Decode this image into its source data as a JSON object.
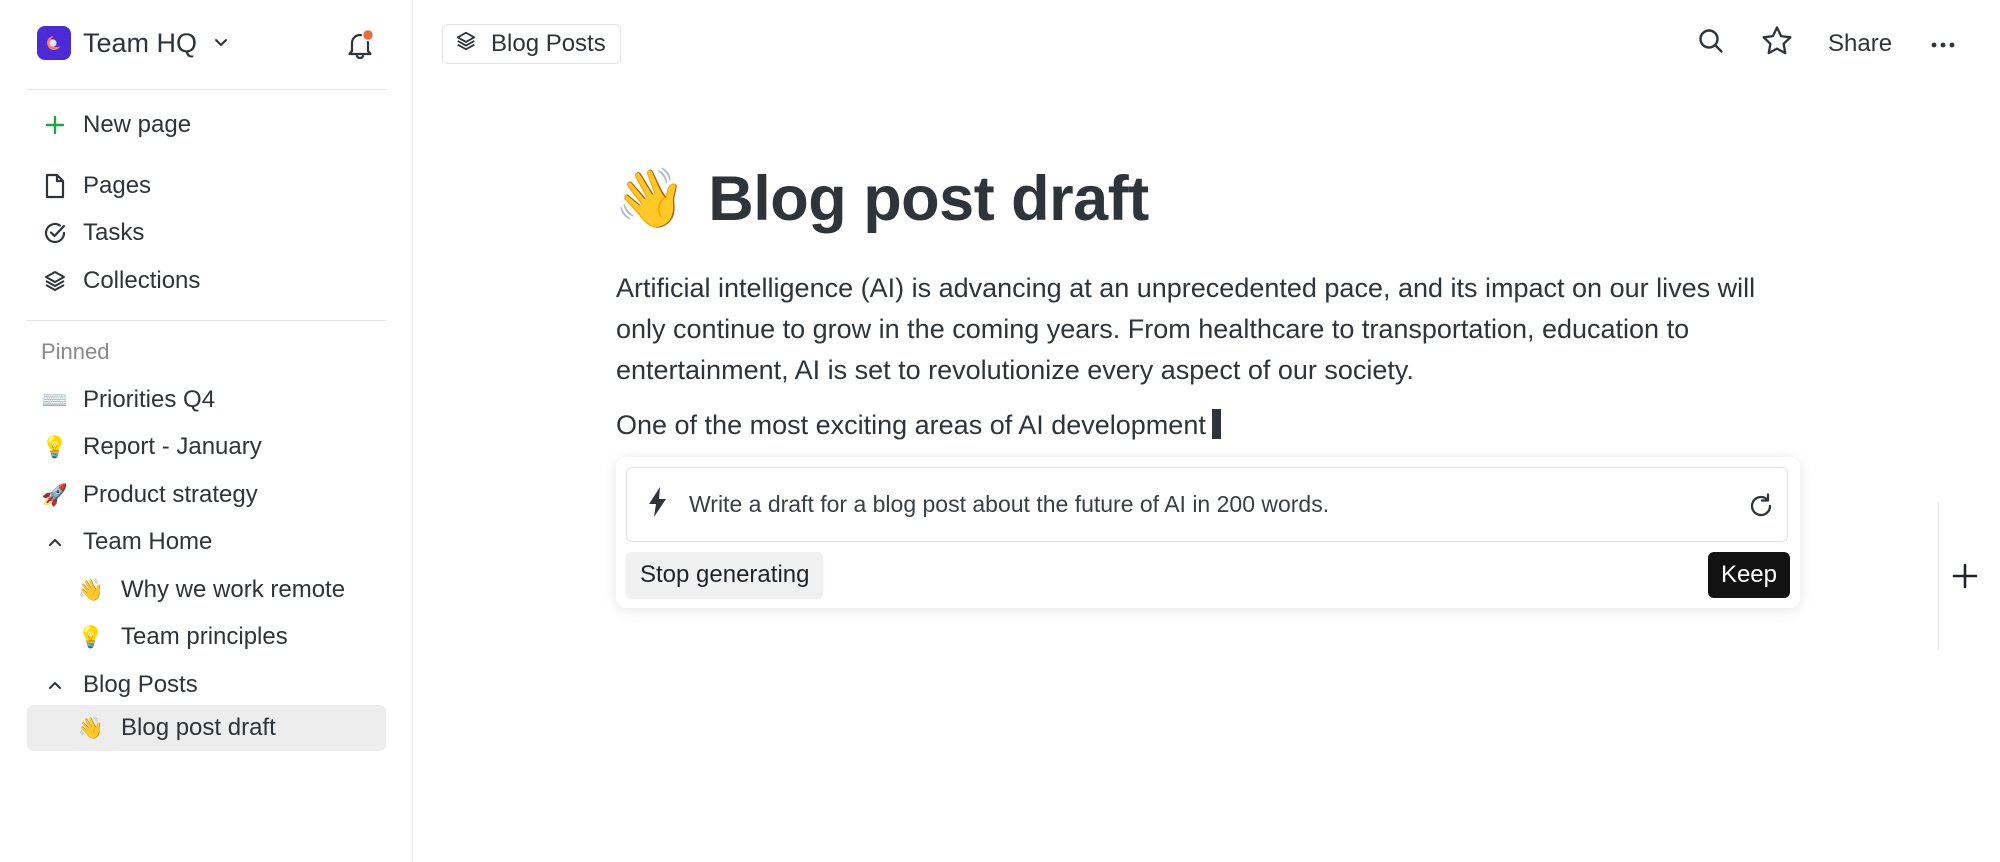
{
  "workspace": {
    "name": "Team HQ"
  },
  "sidebar": {
    "new_page": "New page",
    "primary": [
      {
        "label": "Pages",
        "icon": "page-icon"
      },
      {
        "label": "Tasks",
        "icon": "task-check-icon"
      },
      {
        "label": "Collections",
        "icon": "layers-icon"
      }
    ],
    "pinned_heading": "Pinned",
    "pinned": [
      {
        "emoji": "⌨️",
        "label": "Priorities Q4"
      },
      {
        "emoji": "💡",
        "label": "Report - January"
      },
      {
        "emoji": "🚀",
        "label": "Product strategy"
      },
      {
        "label": "Team Home",
        "expanded": true
      },
      {
        "emoji": "👋",
        "label": "Why we work remote"
      },
      {
        "emoji": "💡",
        "label": "Team principles"
      },
      {
        "label": "Blog Posts",
        "expanded": true
      },
      {
        "emoji": "👋",
        "label": "Blog post draft",
        "active": true
      }
    ]
  },
  "topbar": {
    "breadcrumb": "Blog Posts",
    "share_label": "Share"
  },
  "page": {
    "emoji": "👋",
    "title": "Blog post draft",
    "paragraph1": "Artificial intelligence (AI) is advancing at an unprecedented pace, and its impact on our lives will only continue to grow in the coming years. From healthcare to transportation, education to entertainment, AI is set to revolutionize every aspect of our society.",
    "paragraph2": "One of the most exciting areas of AI development"
  },
  "ai": {
    "prompt": "Write a draft for a blog post about the future of AI in 200 words.",
    "stop_label": "Stop generating",
    "keep_label": "Keep"
  },
  "colors": {
    "accent": "#4b2bd6",
    "notification": "#f26b3a",
    "new_page_plus": "#1aa64a"
  }
}
